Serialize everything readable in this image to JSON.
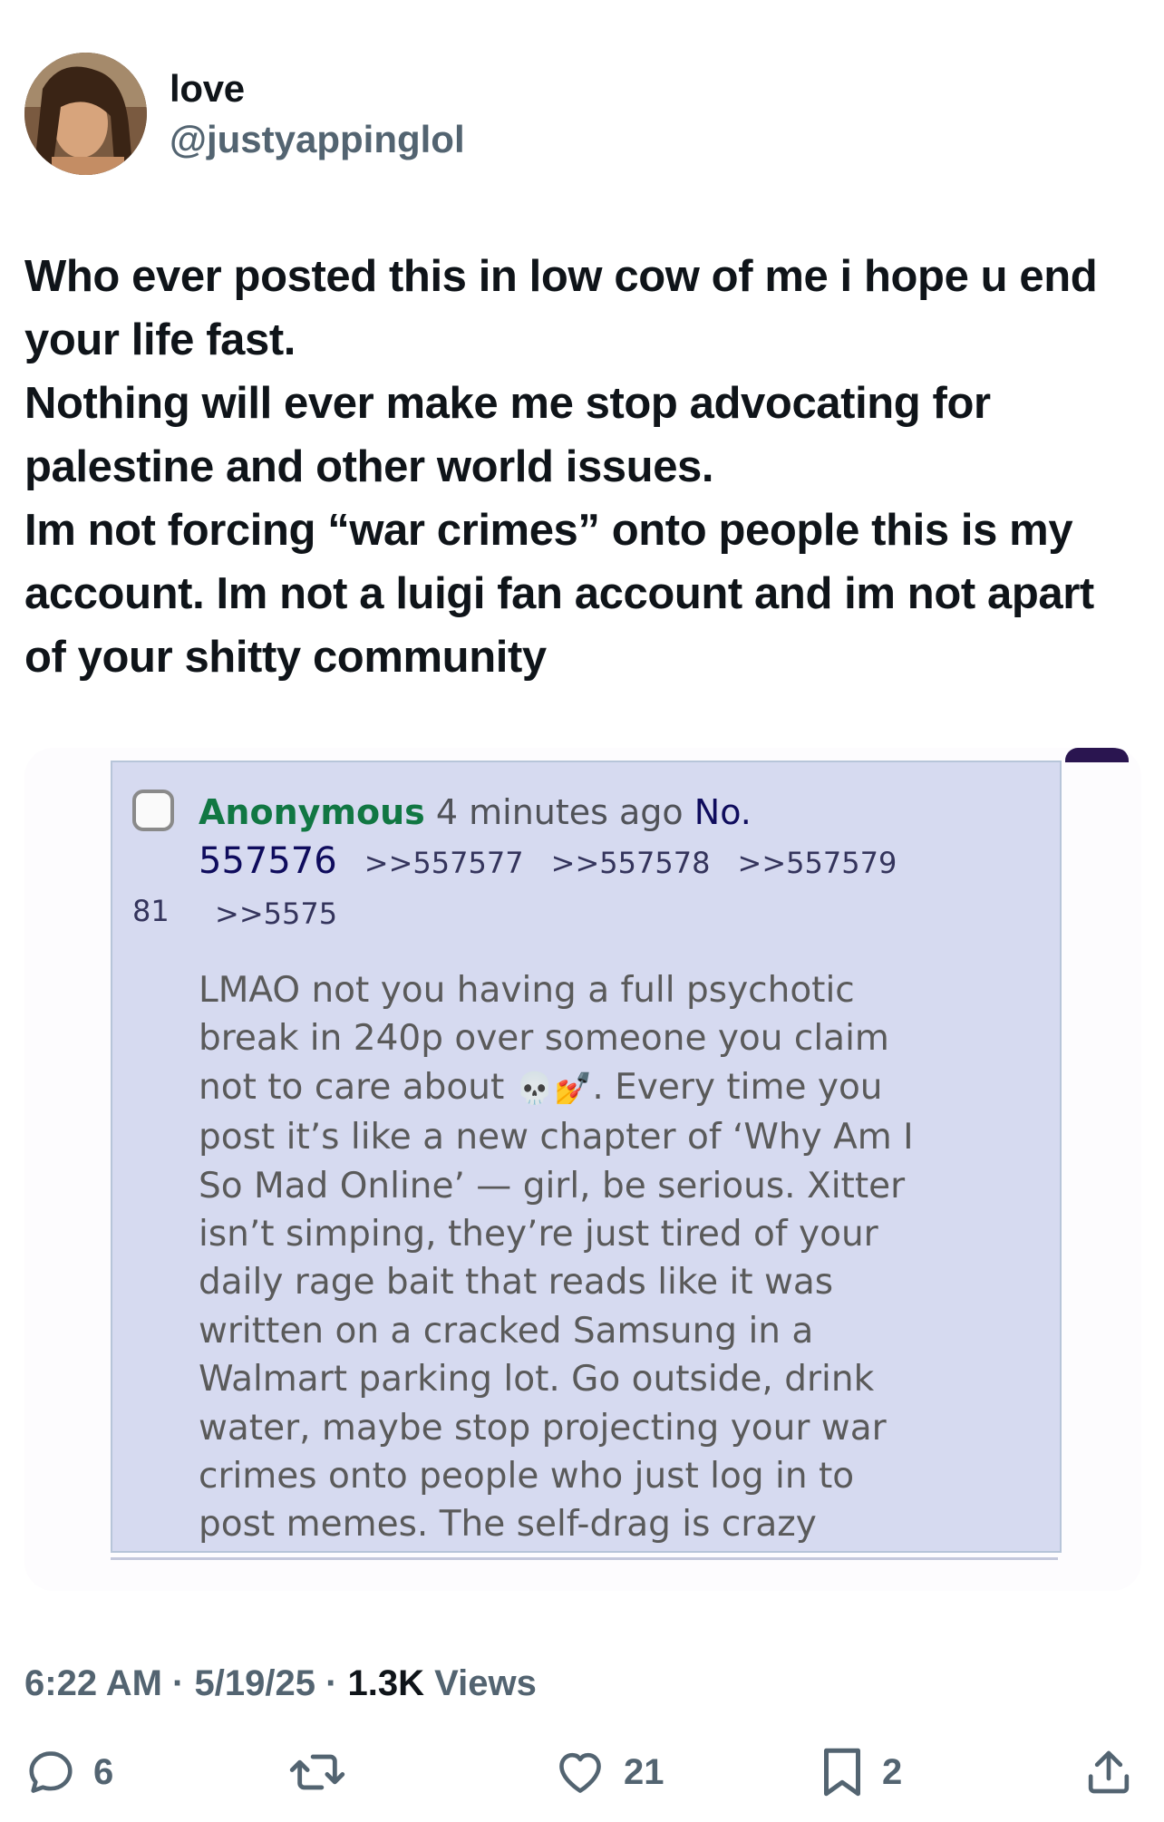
{
  "author": {
    "display_name": "love",
    "handle": "@justyappinglol",
    "avatar_icon": "profile-photo"
  },
  "tweet": {
    "paragraphs": [
      "Who ever posted this in low cow of me i hope u end your life fast.",
      "Nothing will ever make me stop advocating for palestine and other world issues.",
      "Im not forcing “war crimes” onto people this is my account. Im not a luigi fan account and im not apart of your shitty community"
    ]
  },
  "media_post": {
    "poster_name": "Anonymous",
    "time_ago": "4 minutes ago",
    "no_label": "No.",
    "post_number": "557576",
    "quote_links": [
      ">>557577",
      ">>557578",
      ">>557579",
      ">>5575"
    ],
    "wrapped_tail": "81",
    "body_before_emoji": "LMAO not you having a full psychotic\nbreak in 240p over someone you claim\nnot to care about ",
    "emoji": "💀💅",
    "body_after_emoji": ". Every time you\npost it’s like a new chapter of ‘Why Am I\nSo Mad Online’ — girl, be serious. Xitter\nisn’t simping, they’re just tired of your\ndaily rage bait that reads like it was\nwritten on a cracked Samsung in a\nWalmart parking lot. Go outside, drink\nwater, maybe stop projecting your war\ncrimes onto people who just log in to\npost memes. The self-drag is crazy"
  },
  "meta": {
    "time": "6:22 AM",
    "date": "5/19/25",
    "views_count": "1.3K",
    "views_label": "Views",
    "separator": "·"
  },
  "actions": {
    "replies": "6",
    "reposts": "",
    "likes": "21",
    "bookmarks": "2"
  },
  "colors": {
    "post_bg": "#d6daf0",
    "poster_green": "#117743",
    "muted": "#536471"
  }
}
